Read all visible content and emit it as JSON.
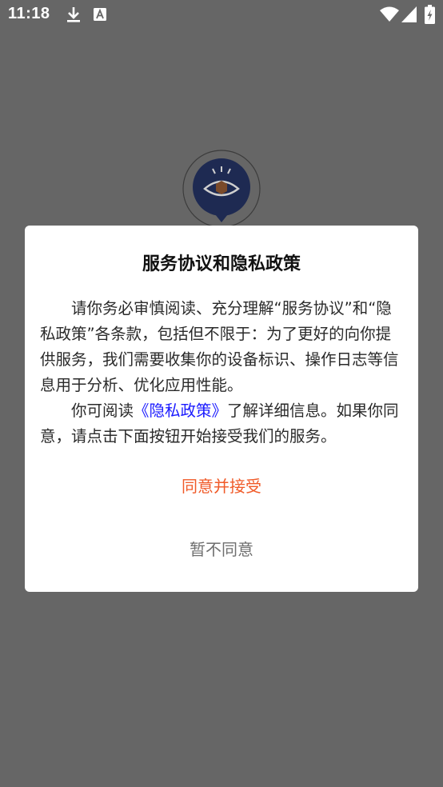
{
  "status_bar": {
    "time": "11:18",
    "icons": [
      "download-icon",
      "font-a-icon",
      "wifi-icon",
      "cell-signal-icon",
      "battery-charging-icon"
    ]
  },
  "background": {
    "color": "#666666",
    "logo_icon": "eye-logo-icon"
  },
  "dialog": {
    "title": "服务协议和隐私政策",
    "paragraph1": "请你务必审慎阅读、充分理解“服务协议”和“隐私政策”各条款，包括但不限于：为了更好的向你提供服务，我们需要收集你的设备标识、操作日志等信息用于分析、优化应用性能。",
    "paragraph2_before": "你可阅读",
    "paragraph2_link": "《隐私政策》",
    "paragraph2_after": "了解详细信息。如果你同意，请点击下面按钮开始接受我们的服务。",
    "accept_label": "同意并接受",
    "decline_label": "暂不同意",
    "colors": {
      "accept": "#f05a28",
      "link": "#1a1aff",
      "decline": "#6f6f6f"
    }
  }
}
